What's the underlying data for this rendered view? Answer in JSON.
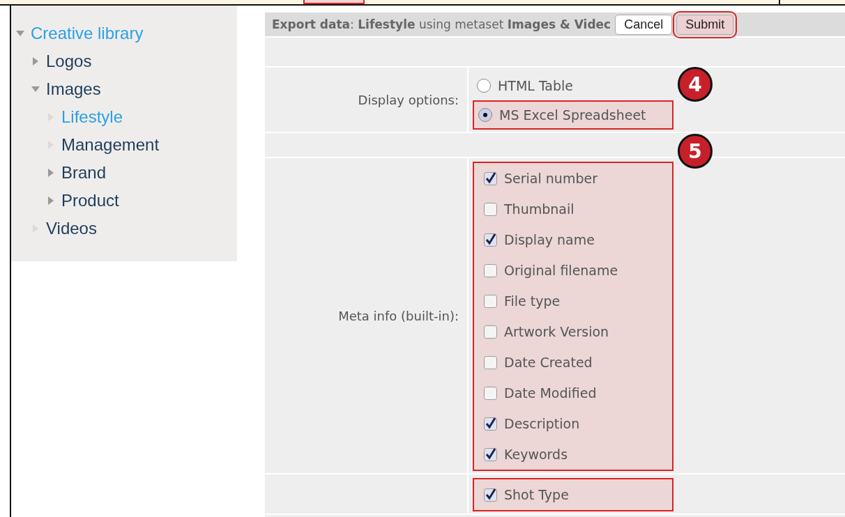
{
  "tree": [
    {
      "label": "Creative library",
      "selected": true,
      "expanded": true,
      "children": [
        {
          "label": "Logos",
          "selected": false,
          "expanded": false,
          "kind": "folder"
        },
        {
          "label": "Images",
          "selected": false,
          "expanded": true,
          "children": [
            {
              "label": "Lifestyle",
              "selected": true,
              "expanded": false,
              "kind": "leaf"
            },
            {
              "label": "Management",
              "selected": false,
              "expanded": false,
              "kind": "leaf"
            },
            {
              "label": "Brand",
              "selected": false,
              "expanded": false,
              "kind": "folder"
            },
            {
              "label": "Product",
              "selected": false,
              "expanded": false,
              "kind": "folder"
            }
          ]
        },
        {
          "label": "Videos",
          "selected": false,
          "expanded": false,
          "kind": "leaf"
        }
      ]
    }
  ],
  "header": {
    "title": "**Export data**: **Lifestyle** using metaset **Images & Videc**",
    "buttons": [
      {
        "label": "Cancel",
        "highlighted": false
      },
      {
        "label": "Submit",
        "highlighted": true
      }
    ]
  },
  "form": [
    {
      "kind": "radio",
      "label": "Display options:",
      "callout": "4",
      "options": [
        {
          "label": "HTML Table",
          "selected": false,
          "highlighted": false
        },
        {
          "label": "MS Excel Spreadsheet",
          "selected": true,
          "highlighted": true
        }
      ]
    },
    {
      "kind": "checkbox",
      "label": "Meta info (built-in):",
      "callout": "5",
      "highlighted": true,
      "options": [
        {
          "label": "Serial number",
          "checked": true
        },
        {
          "label": "Thumbnail",
          "checked": false
        },
        {
          "label": "Display name",
          "checked": true
        },
        {
          "label": "Original filename",
          "checked": false
        },
        {
          "label": "File type",
          "checked": false
        },
        {
          "label": "Artwork Version",
          "checked": false
        },
        {
          "label": "Date Created",
          "checked": false
        },
        {
          "label": "Date Modified",
          "checked": false
        },
        {
          "label": "Description",
          "checked": true
        },
        {
          "label": "Keywords",
          "checked": true
        }
      ]
    },
    {
      "kind": "checkbox",
      "highlighted": true,
      "options": [
        {
          "label": "Shot Type",
          "checked": true
        }
      ]
    }
  ]
}
